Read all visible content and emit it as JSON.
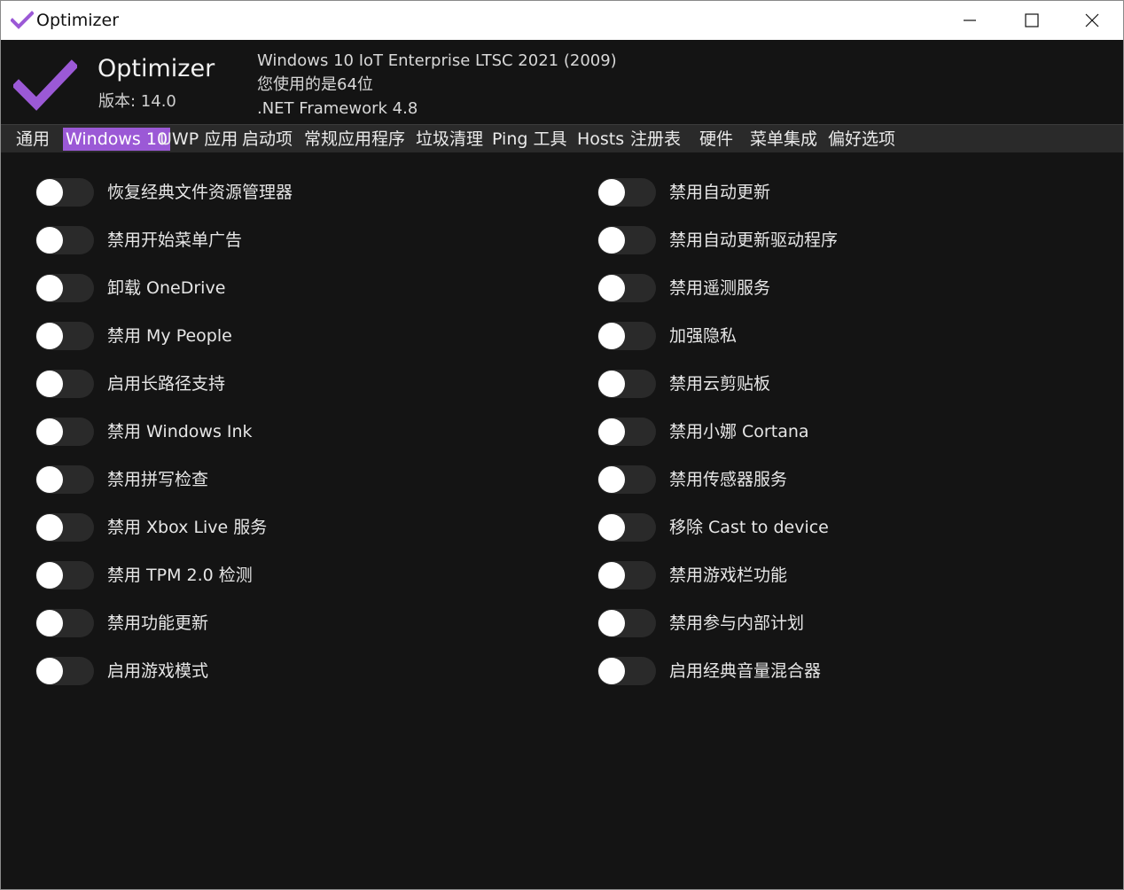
{
  "window": {
    "title": "Optimizer",
    "icon": "checkmark-icon",
    "controls": [
      "minimize-icon",
      "maximize-icon",
      "close-icon"
    ]
  },
  "header": {
    "app_name": "Optimizer",
    "version": "版本: 14.0",
    "os": "Windows 10 IoT Enterprise LTSC 2021 (2009)",
    "bits": "您使用的是64位",
    "netfx": ".NET Framework 4.8",
    "accent": "#9b59d6"
  },
  "tabs": [
    {
      "label": "通用",
      "active": false
    },
    {
      "label": "Windows 10",
      "active": true
    },
    {
      "label": "UWP 应用",
      "active": false
    },
    {
      "label": "启动项",
      "active": false
    },
    {
      "label": "常规应用程序",
      "active": false
    },
    {
      "label": "垃圾清理",
      "active": false
    },
    {
      "label": "Ping 工具",
      "active": false
    },
    {
      "label": "Hosts",
      "active": false
    },
    {
      "label": "注册表",
      "active": false
    },
    {
      "label": "硬件",
      "active": false
    },
    {
      "label": "菜单集成",
      "active": false
    },
    {
      "label": "偏好选项",
      "active": false
    }
  ],
  "options_left": [
    {
      "label": "恢复经典文件资源管理器",
      "on": false
    },
    {
      "label": "禁用开始菜单广告",
      "on": false
    },
    {
      "label": "卸载 OneDrive",
      "on": false
    },
    {
      "label": "禁用 My People",
      "on": false
    },
    {
      "label": "启用长路径支持",
      "on": false
    },
    {
      "label": "禁用 Windows Ink",
      "on": false
    },
    {
      "label": "禁用拼写检查",
      "on": false
    },
    {
      "label": "禁用 Xbox Live 服务",
      "on": false
    },
    {
      "label": "禁用 TPM 2.0 检测",
      "on": false
    },
    {
      "label": "禁用功能更新",
      "on": false
    },
    {
      "label": "启用游戏模式",
      "on": false
    }
  ],
  "options_right": [
    {
      "label": "禁用自动更新",
      "on": false
    },
    {
      "label": "禁用自动更新驱动程序",
      "on": false
    },
    {
      "label": "禁用遥测服务",
      "on": false
    },
    {
      "label": "加强隐私",
      "on": false
    },
    {
      "label": "禁用云剪贴板",
      "on": false
    },
    {
      "label": "禁用小娜 Cortana",
      "on": false
    },
    {
      "label": "禁用传感器服务",
      "on": false
    },
    {
      "label": "移除 Cast to device",
      "on": false
    },
    {
      "label": "禁用游戏栏功能",
      "on": false
    },
    {
      "label": "禁用参与内部计划",
      "on": false
    },
    {
      "label": "启用经典音量混合器",
      "on": false
    }
  ]
}
